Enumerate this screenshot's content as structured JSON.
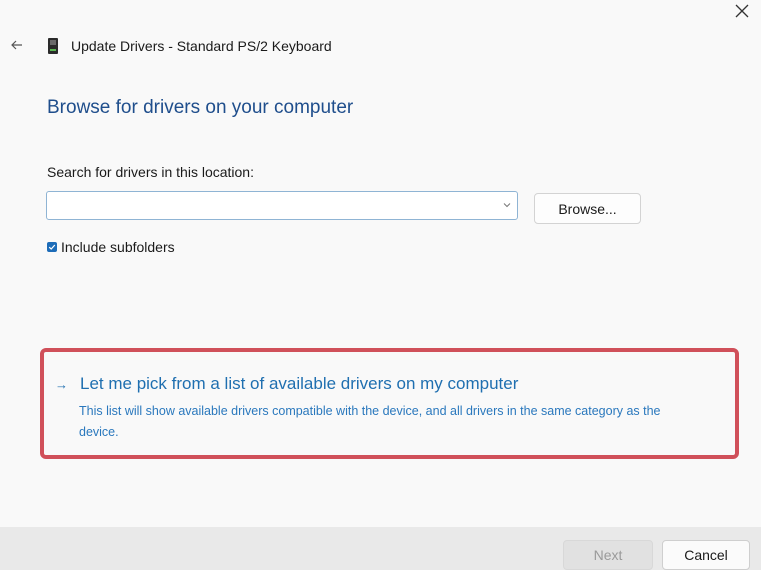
{
  "window": {
    "title": "Update Drivers - Standard PS/2 Keyboard",
    "close_icon": "close-icon",
    "back_icon": "back-arrow-icon",
    "device_icon": "keyboard-device-icon"
  },
  "main": {
    "heading": "Browse for drivers on your computer",
    "search_label": "Search for drivers in this location:",
    "path_value": "",
    "browse_label": "Browse...",
    "include_subfolders_label": "Include subfolders",
    "include_subfolders_checked": true
  },
  "pick_option": {
    "arrow": "→",
    "title": "Let me pick from a list of available drivers on my computer",
    "description": "This list will show available drivers compatible with the device, and all drivers in the same category as the device."
  },
  "footer": {
    "next_label": "Next",
    "cancel_label": "Cancel"
  },
  "colors": {
    "accent": "#1f6fb0",
    "heading": "#1f4e8c",
    "highlight_border": "#d0505a"
  }
}
